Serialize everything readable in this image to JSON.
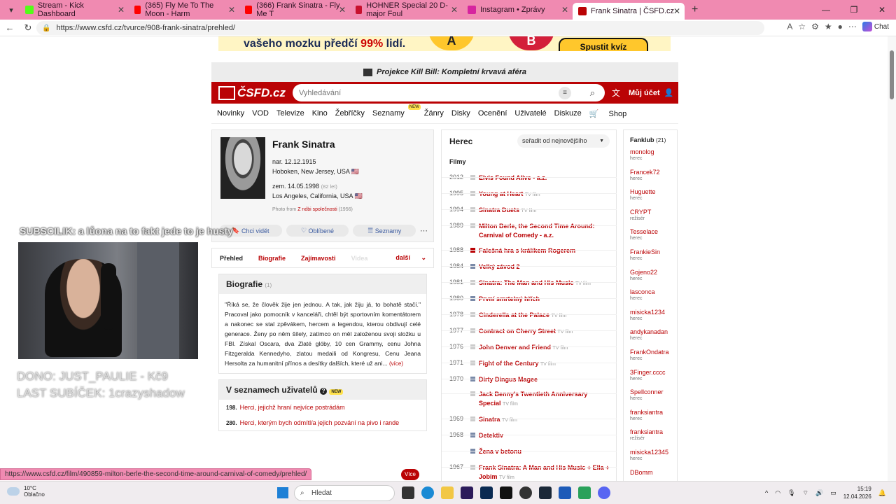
{
  "browser": {
    "tabs": [
      {
        "title": "Stream - Kick Dashboard",
        "fav_color": "#53fc18"
      },
      {
        "title": "(365) Fly Me To The Moon - Harm",
        "fav_color": "#ff0000"
      },
      {
        "title": "(366) Frank Sinatra - Fly Me T",
        "fav_color": "#ff0000"
      },
      {
        "title": "HOHNER Special 20 D-major Foul",
        "fav_color": "#c8102e"
      },
      {
        "title": "Instagram • Zprávy",
        "fav_color": "#d6249f"
      },
      {
        "title": "Frank Sinatra | ČSFD.cz",
        "fav_color": "#ba0305"
      }
    ],
    "url": "https://www.csfd.cz/tvurce/908-frank-sinatra/prehled/",
    "chat_label": "Chat"
  },
  "ad": {
    "text_pre": "vašeho mozku předčí",
    "text_pct": "99%",
    "text_post": "lidí.",
    "opt_a": "A",
    "opt_b": "B",
    "cta": "Spustit kvíz"
  },
  "site": {
    "promo": "Projekce Kill Bill: Kompletní krvavá aféra",
    "logo": "ČSFD.cz",
    "search_placeholder": "Vyhledávání",
    "account": "Můj účet",
    "menu": [
      "Novinky",
      "VOD",
      "Televize",
      "Kino",
      "Žebříčky",
      "Seznamy",
      "Žánry",
      "Disky",
      "Ocenění",
      "Uživatelé",
      "Diskuze",
      "Shop"
    ],
    "menu_new_badge": "NEW"
  },
  "profile": {
    "name": "Frank Sinatra",
    "born": "nar. 12.12.1915",
    "born_place": "Hoboken, New Jersey, USA",
    "died": "zem. 14.05.1998",
    "died_age": "(82 let)",
    "died_place": "Los Angeles, California, USA",
    "photo_prefix": "Photo from",
    "photo_link": "Z nóbi společnosti",
    "photo_year": "(1956)",
    "actions": [
      "Chci vidět",
      "Oblíbené",
      "Seznamy"
    ]
  },
  "tabs": {
    "items": [
      "Přehled",
      "Biografie",
      "Zajímavosti",
      "Videa"
    ],
    "more": "další"
  },
  "bio": {
    "title": "Biografie",
    "count": "(1)",
    "text": "\"Říká se, že člověk žije jen jednou. A tak, jak žiju já, to bohatě stačí.\" Pracoval jako pomocník v kanceláři, chtěl být sportovním komentátorem a nakonec se stal zpěvákem, hercem a legendou, kterou obdivují celé generace. Ženy po něm šílely, zatímco on měl založenou svoji složku u FBI. Získal Oscara, dva Zlaté glóby, 10 cen Grammy, cenu Johna Fitzgeralda Kennedyho, zlatou medaili od Kongresu, Cenu Jeana Hersolta za humanitní přínos a desítky dalších, které už ani...",
    "more": "(více)"
  },
  "lists": {
    "title": "V seznamech uživatelů",
    "badge": "NEW",
    "items": [
      {
        "rank": "198.",
        "label": "Herci, jejichž hraní nejvíce postrádám"
      },
      {
        "rank": "280.",
        "label": "Herci, kterým bych odmítl/a jejich pozvání na pivo i rande"
      }
    ],
    "more_button": "Více"
  },
  "filmography": {
    "title": "Herec",
    "sort": "seřadit od nejnovějšího",
    "section": "Filmy",
    "rows": [
      {
        "year": "2012",
        "title": "Elvis Found Alive",
        "extra": "- a.z.",
        "note": "",
        "sq": "#cccccc"
      },
      {
        "year": "1995",
        "title": "Young at Heart",
        "extra": "",
        "note": "TV film",
        "sq": "#cccccc"
      },
      {
        "year": "1994",
        "title": "Sinatra Duets",
        "extra": "",
        "note": "TV film",
        "sq": "#cccccc"
      },
      {
        "year": "1989",
        "title": "Milton Berle, the Second Time Around: Carnival of Comedy",
        "extra": "- a.z.",
        "note": "",
        "sq": "#cccccc"
      },
      {
        "year": "1988",
        "title": "Falešná hra s králíkem Rogerem",
        "extra": "",
        "note": "",
        "sq": "#ba0305"
      },
      {
        "year": "1984",
        "title": "Velký závod 2",
        "extra": "",
        "note": "",
        "sq": "#7a8aa8"
      },
      {
        "year": "1981",
        "title": "Sinatra: The Man and His Music",
        "extra": "",
        "note": "TV film",
        "sq": "#cccccc"
      },
      {
        "year": "1980",
        "title": "První smrtelný hřích",
        "extra": "",
        "note": "",
        "sq": "#7a8aa8"
      },
      {
        "year": "1978",
        "title": "Cinderella at the Palace",
        "extra": "",
        "note": "TV film",
        "sq": "#cccccc"
      },
      {
        "year": "1977",
        "title": "Contract on Cherry Street",
        "extra": "",
        "note": "TV film",
        "sq": "#cccccc"
      },
      {
        "year": "1976",
        "title": "John Denver and Friend",
        "extra": "",
        "note": "TV film",
        "sq": "#cccccc"
      },
      {
        "year": "1971",
        "title": "Fight of the Century",
        "extra": "",
        "note": "TV film",
        "sq": "#cccccc"
      },
      {
        "year": "1970",
        "title": "Dirty Dingus Magee",
        "extra": "",
        "note": "",
        "sq": "#7a8aa8"
      },
      {
        "year": "",
        "title": "Jack Benny's Twentieth Anniversary Special",
        "extra": "",
        "note": "TV film",
        "sq": "#cccccc"
      },
      {
        "year": "1969",
        "title": "Sinatra",
        "extra": "",
        "note": "TV film",
        "sq": "#cccccc"
      },
      {
        "year": "1968",
        "title": "Detektiv",
        "extra": "",
        "note": "",
        "sq": "#7a8aa8"
      },
      {
        "year": "",
        "title": "Žena v betonu",
        "extra": "",
        "note": "",
        "sq": "#7a8aa8"
      },
      {
        "year": "1967",
        "title": "Frank Sinatra: A Man and His Music + Ella + Jobim",
        "extra": "",
        "note": "TV film",
        "sq": "#cccccc"
      }
    ]
  },
  "fanclub": {
    "title": "Fanklub",
    "count": "(21)",
    "fans": [
      {
        "name": "monolog",
        "role": "herec"
      },
      {
        "name": "Francek72",
        "role": "herec"
      },
      {
        "name": "Huguette",
        "role": "herec"
      },
      {
        "name": "CRYPT",
        "role": "režisér"
      },
      {
        "name": "Tesselace",
        "role": "herec"
      },
      {
        "name": "FrankieSin",
        "role": "herec"
      },
      {
        "name": "Gojeno22",
        "role": "herec"
      },
      {
        "name": "lasconca",
        "role": "herec"
      },
      {
        "name": "misicka1234",
        "role": "herec"
      },
      {
        "name": "andykanadan",
        "role": "herec"
      },
      {
        "name": "FrankOndatra",
        "role": "herec"
      },
      {
        "name": "3Finger.cccc",
        "role": "herec"
      },
      {
        "name": "Spellconner",
        "role": "herec"
      },
      {
        "name": "franksiantra",
        "role": "herec"
      },
      {
        "name": "franksiantra",
        "role": "režisér"
      },
      {
        "name": "misicka12345",
        "role": "herec"
      },
      {
        "name": "DBomm",
        "role": ""
      }
    ]
  },
  "overlay": {
    "chat_line": "SUBSCILIK: a lůona na to fakt jede to je husty",
    "dono": "DONO: JUST_PAULIE - Kč9",
    "last_sub": "LAST SUBÍČEK: 1crazyshadow"
  },
  "status_url": "https://www.csfd.cz/film/490859-milton-berle-the-second-time-around-carnival-of-comedy/prehled/",
  "taskbar": {
    "temp": "10°C",
    "weather": "Oblačno",
    "search": "Hledat",
    "time": "15:19",
    "date": "12.04.2026"
  }
}
